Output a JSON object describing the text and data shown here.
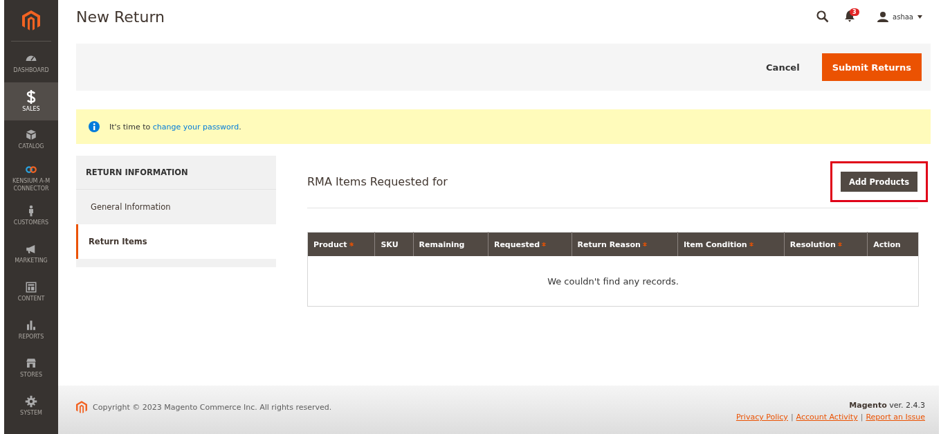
{
  "sidebar": {
    "items": [
      {
        "label": "DASHBOARD",
        "selected": false
      },
      {
        "label": "SALES",
        "selected": true
      },
      {
        "label": "CATALOG",
        "selected": false
      },
      {
        "label": "KENSIUM A-M CONNECTOR",
        "selected": false
      },
      {
        "label": "CUSTOMERS",
        "selected": false
      },
      {
        "label": "MARKETING",
        "selected": false
      },
      {
        "label": "CONTENT",
        "selected": false
      },
      {
        "label": "REPORTS",
        "selected": false
      },
      {
        "label": "STORES",
        "selected": false
      },
      {
        "label": "SYSTEM",
        "selected": false
      }
    ]
  },
  "header": {
    "title": "New Return",
    "notifications": "3",
    "user": "ashaa"
  },
  "actions": {
    "cancel": "Cancel",
    "submit": "Submit Returns"
  },
  "message": {
    "text": "It's time to ",
    "link": "change your password",
    "after": "."
  },
  "tabs": {
    "title": "RETURN INFORMATION",
    "items": [
      {
        "label": "General Information",
        "selected": false
      },
      {
        "label": "Return Items",
        "selected": true
      }
    ]
  },
  "items_section": {
    "title": "RMA Items Requested for",
    "add_button": {
      "label": "Add Products",
      "highlighted": true
    }
  },
  "table": {
    "columns": [
      {
        "label": "Product",
        "required": true
      },
      {
        "label": "SKU",
        "required": false
      },
      {
        "label": "Remaining",
        "required": false
      },
      {
        "label": "Requested",
        "required": true
      },
      {
        "label": "Return Reason",
        "required": true
      },
      {
        "label": "Item Condition",
        "required": true
      },
      {
        "label": "Resolution",
        "required": true
      },
      {
        "label": "Action",
        "required": false
      }
    ],
    "empty_text": "We couldn't find any records."
  },
  "footer": {
    "copyright": "Copyright © 2023 Magento Commerce Inc. All rights reserved.",
    "brand": "Magento",
    "version": " ver. 2.4.3",
    "links": [
      "Privacy Policy",
      "Account Activity",
      "Report an Issue"
    ],
    "separator": "|"
  }
}
